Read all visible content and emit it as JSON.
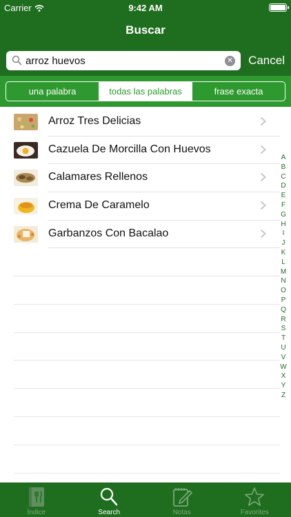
{
  "status_bar": {
    "carrier": "Carrier",
    "time": "9:42 AM"
  },
  "nav": {
    "title": "Buscar"
  },
  "search": {
    "value": "arroz huevos",
    "cancel_label": "Cancel"
  },
  "segments": [
    {
      "label": "una palabra",
      "active": false
    },
    {
      "label": "todas las palabras",
      "active": true
    },
    {
      "label": "frase exacta",
      "active": false
    }
  ],
  "results": [
    {
      "label": "Arroz Tres Delicias",
      "thumb": "arroz-thumbnail"
    },
    {
      "label": "Cazuela De Morcilla Con Huevos",
      "thumb": "cazuela-thumbnail"
    },
    {
      "label": "Calamares Rellenos",
      "thumb": "calamares-thumbnail"
    },
    {
      "label": "Crema De Caramelo",
      "thumb": "crema-thumbnail"
    },
    {
      "label": "Garbanzos Con Bacalao",
      "thumb": "garbanzos-thumbnail"
    }
  ],
  "index_letters": [
    "A",
    "B",
    "C",
    "D",
    "E",
    "F",
    "G",
    "H",
    "I",
    "J",
    "K",
    "L",
    "M",
    "N",
    "O",
    "P",
    "Q",
    "R",
    "S",
    "T",
    "U",
    "V",
    "W",
    "X",
    "Y",
    "Z"
  ],
  "tabs": [
    {
      "label": "Índice",
      "icon": "book-utensils-icon",
      "active": false
    },
    {
      "label": "Search",
      "icon": "search-icon",
      "active": true
    },
    {
      "label": "Notas",
      "icon": "notepad-pencil-icon",
      "active": false
    },
    {
      "label": "Favorites",
      "icon": "star-icon",
      "active": false
    }
  ],
  "colors": {
    "bar_green": "#1f6e1f",
    "segment_green": "#2e992e"
  }
}
